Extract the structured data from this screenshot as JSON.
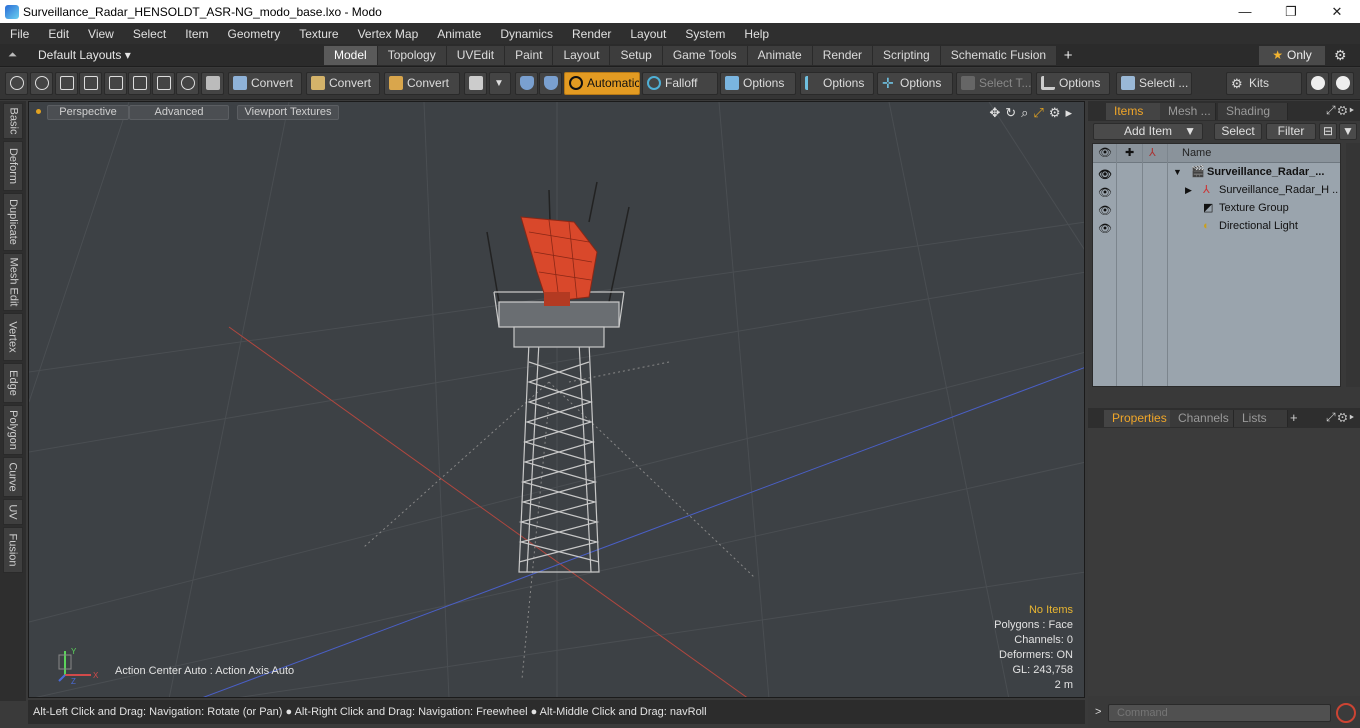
{
  "window": {
    "title": "Surveillance_Radar_HENSOLDT_ASR-NG_modo_base.lxo - Modo",
    "minimize": "—",
    "maximize": "❐",
    "close": "✕"
  },
  "menu": [
    "File",
    "Edit",
    "View",
    "Select",
    "Item",
    "Geometry",
    "Texture",
    "Vertex Map",
    "Animate",
    "Dynamics",
    "Render",
    "Layout",
    "System",
    "Help"
  ],
  "layout_bar": {
    "default_layouts": "Default Layouts ▾",
    "tabs": [
      "Model",
      "Topology",
      "UVEdit",
      "Paint",
      "Layout",
      "Setup",
      "Game Tools",
      "Animate",
      "Render",
      "Scripting",
      "Schematic Fusion"
    ],
    "active_tab": "Model",
    "plus": "+",
    "only_label": "Only",
    "star": "★",
    "gear": "⚙"
  },
  "toolbar": {
    "convert1": "Convert",
    "convert2": "Convert",
    "convert3": "Convert",
    "automatic": "Automatic",
    "falloff": "Falloff",
    "options1": "Options",
    "options2": "Options",
    "options3": "Options",
    "select_t": "Select T...",
    "options4": "Options",
    "selecti": "Selecti ...",
    "kits": "Kits"
  },
  "left_tabs": [
    "Basic",
    "Deform",
    "Duplicate",
    "Mesh Edit",
    "Vertex",
    "Edge",
    "Polygon",
    "Curve",
    "UV",
    "Fusion"
  ],
  "viewport": {
    "perspective": "Perspective",
    "advanced": "Advanced",
    "viewport_textures": "Viewport Textures",
    "tools": [
      "✥",
      "↻",
      "⌕",
      "⤢",
      "⚙",
      "▸"
    ],
    "info": {
      "no_items": "No Items",
      "polygons": "Polygons : Face",
      "channels": "Channels: 0",
      "deformers": "Deformers: ON",
      "gl": "GL: 243,758",
      "scale": "2 m"
    },
    "action_center": "Action Center Auto : Action Axis Auto",
    "gizmo": {
      "x": "X",
      "y": "Y",
      "z": "Z"
    }
  },
  "status_bar": "Alt-Left Click and Drag: Navigation: Rotate (or Pan) ● Alt-Right Click and Drag: Navigation: Freewheel ● Alt-Middle Click and Drag: navRoll",
  "items_panel": {
    "tabs": [
      "Items",
      "Mesh ...",
      "Shading"
    ],
    "add_item": "Add Item",
    "select": "Select",
    "filter": "Filter",
    "column_name": "Name",
    "rows": [
      {
        "label": "Surveillance_Radar_...",
        "expander": "▼"
      },
      {
        "label": "Surveillance_Radar_H ...",
        "expander": "▶"
      },
      {
        "label": "Texture Group",
        "expander": ""
      },
      {
        "label": "Directional Light",
        "expander": ""
      }
    ]
  },
  "properties_panel": {
    "tabs": [
      "Properties",
      "Channels",
      "Lists"
    ],
    "plus": "+"
  },
  "command": {
    "prompt": ">",
    "placeholder": "Command"
  },
  "colors": {
    "accent": "#f0a629",
    "automatic_bg": "#e39b22",
    "viewport_bg": "#3d4145",
    "radar_red": "#d9482b"
  }
}
